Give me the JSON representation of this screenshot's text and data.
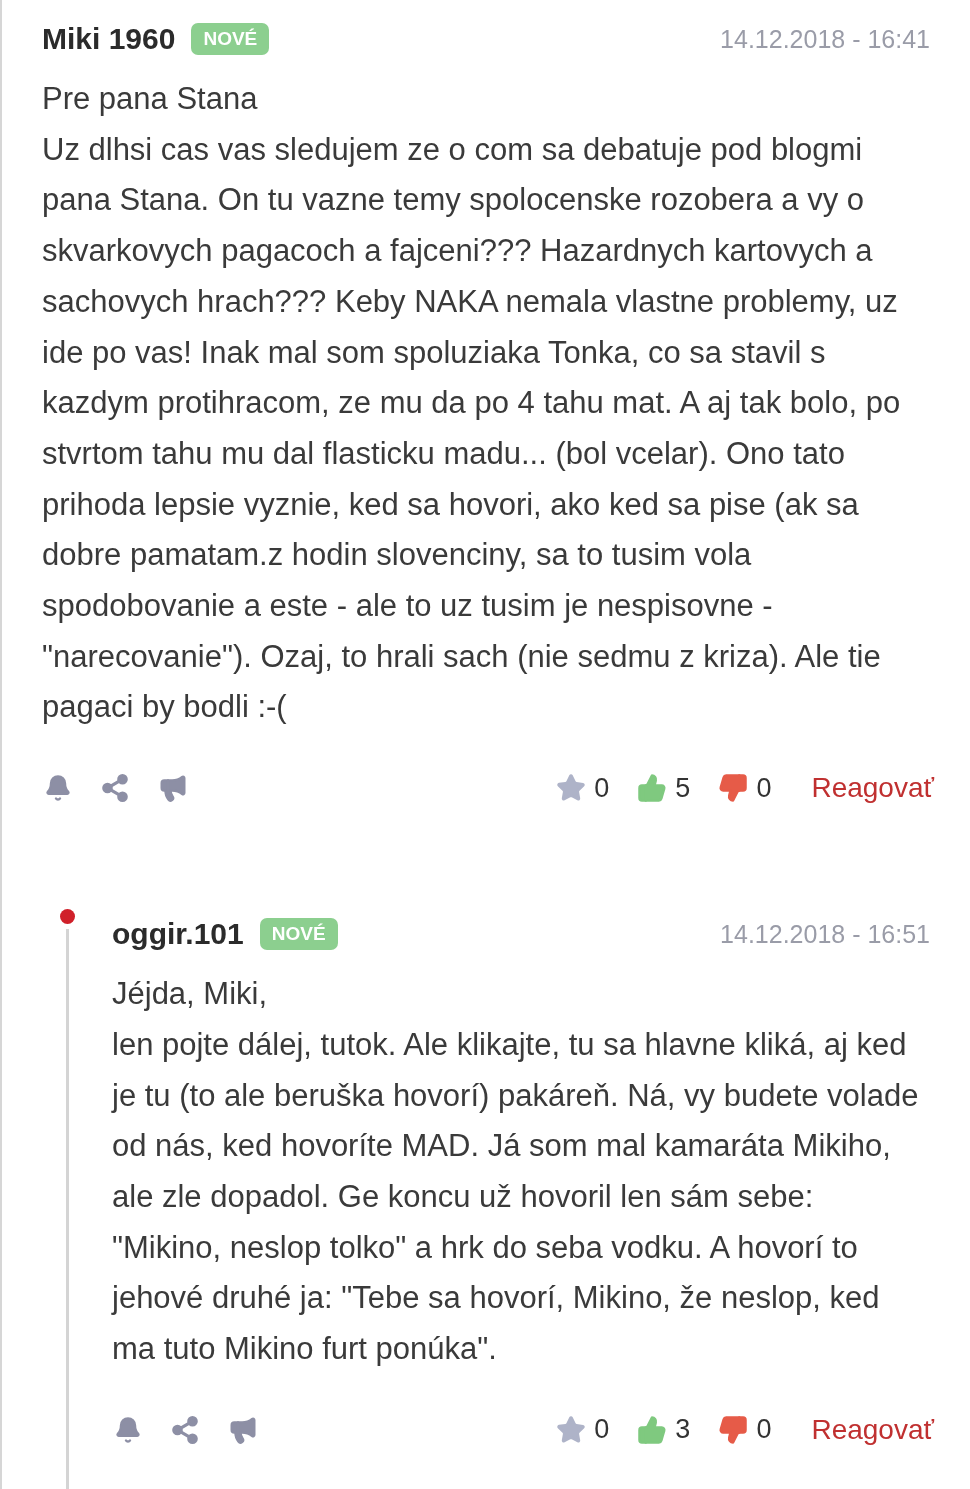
{
  "comments": [
    {
      "author": "Miki 1960",
      "badge": "NOVÉ",
      "date": "14.12.2018 - 16:41",
      "lines": [
        "Pre pana Stana",
        "Uz dlhsi cas vas sledujem ze o com sa debatuje pod blogmi pana Stana. On tu vazne temy spolocenske rozobera a vy o skvarkovych pagacoch a fajceni??? Hazardnych kartovych a sachovych hrach??? Keby NAKA nemala vlastne problemy, uz ide po vas! Inak mal som spoluziaka Tonka, co sa stavil s kazdym protihracom, ze mu da po 4 tahu mat. A aj tak bolo, po stvrtom tahu mu dal flasticku madu... (bol vcelar). Ono tato prihoda lepsie vyznie, ked sa hovori, ako ked sa pise (ak sa dobre pamatam.z hodin slovenciny, sa to tusim vola spodobovanie a este - ale to uz tusim je nespisovne - \"narecovanie\"). Ozaj, to hrali sach (nie sedmu z kriza). Ale tie pagaci by bodli :-("
      ],
      "stars": "0",
      "likes": "5",
      "dislikes": "0",
      "reply": "Reagovať",
      "children": [
        {
          "author": "oggir.101",
          "badge": "NOVÉ",
          "date": "14.12.2018 - 16:51",
          "lines": [
            "Jéjda, Miki,",
            "len pojte dálej, tutok. Ale klikajte, tu sa hlavne kliká, aj ked je tu (to ale beruška hovorí) pakáreň. Ná, vy budete volade od nás, ked hovoríte MAD. Já som mal kamaráta Mikiho, ale zle dopadol. Ge koncu už hovoril len sám sebe: \"Mikino, neslop tolko\" a hrk do seba vodku. A hovorí to jehové druhé ja: \"Tebe sa hovorí, Mikino, že neslop, ked ma tuto Mikino furt ponúka\"."
          ],
          "stars": "0",
          "likes": "3",
          "dislikes": "0",
          "reply": "Reagovať"
        }
      ]
    }
  ]
}
